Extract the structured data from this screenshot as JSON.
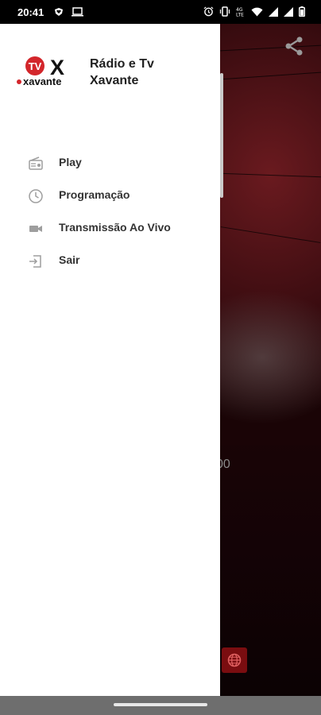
{
  "status_bar": {
    "time": "20:41",
    "left_icons": [
      "shield-heart-icon",
      "laptop-icon"
    ],
    "right_icons": [
      "alarm-icon",
      "vibrate-icon",
      "lte-icon",
      "wifi-icon",
      "signal-icon",
      "signal-icon",
      "battery-icon"
    ]
  },
  "drawer": {
    "app_name": "Rádio e Tv Xavante",
    "logo_text": {
      "tv": "TV",
      "x": "X",
      "brand": "xavante"
    },
    "menu": [
      {
        "label": "Play",
        "icon": "radio-icon"
      },
      {
        "label": "Programação",
        "icon": "clock-icon"
      },
      {
        "label": "Transmissão Ao Vivo",
        "icon": "videocam-icon"
      },
      {
        "label": "Sair",
        "icon": "exit-icon"
      }
    ]
  },
  "background": {
    "time_fragment": "00",
    "accent_color": "#7a0d10"
  }
}
